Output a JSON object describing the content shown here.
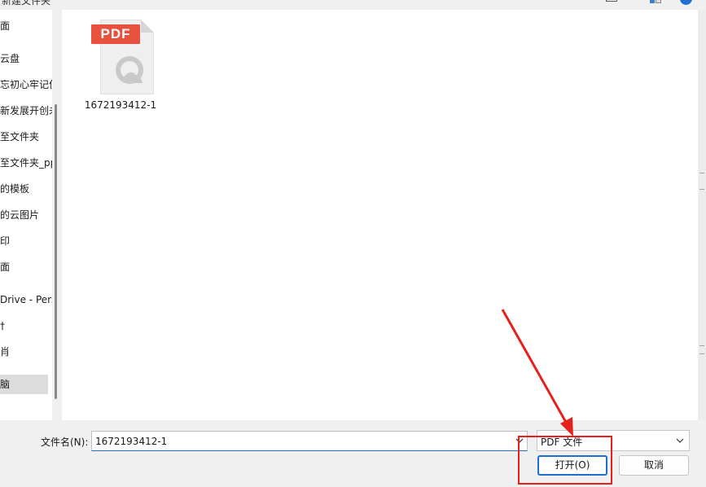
{
  "window": {
    "title": "新建文件夹"
  },
  "sidebar": {
    "items": [
      {
        "label": "面"
      },
      {
        "label": "云盘"
      },
      {
        "label": "忘初心牢记使"
      },
      {
        "label": "新发展开创未"
      },
      {
        "label": "至文件夹"
      },
      {
        "label": "至文件夹_pp"
      },
      {
        "label": "的模板"
      },
      {
        "label": "的云图片"
      },
      {
        "label": "印"
      },
      {
        "label": "面"
      },
      {
        "label": "Drive - Pers"
      },
      {
        "label": "†"
      },
      {
        "label": "肖"
      },
      {
        "label": "脑"
      }
    ]
  },
  "files": [
    {
      "name": "1672193412-1",
      "icon": "pdf-file-icon",
      "badge": "PDF"
    }
  ],
  "footer": {
    "filename_label": "文件名(N):",
    "filename_value": "1672193412-1",
    "filetype_value": "PDF 文件",
    "open_label": "打开(O)",
    "cancel_label": "取消"
  },
  "colors": {
    "accent": "#1f6fd1",
    "pdf_badge": "#e8513e",
    "annotation": "#e8201c"
  }
}
